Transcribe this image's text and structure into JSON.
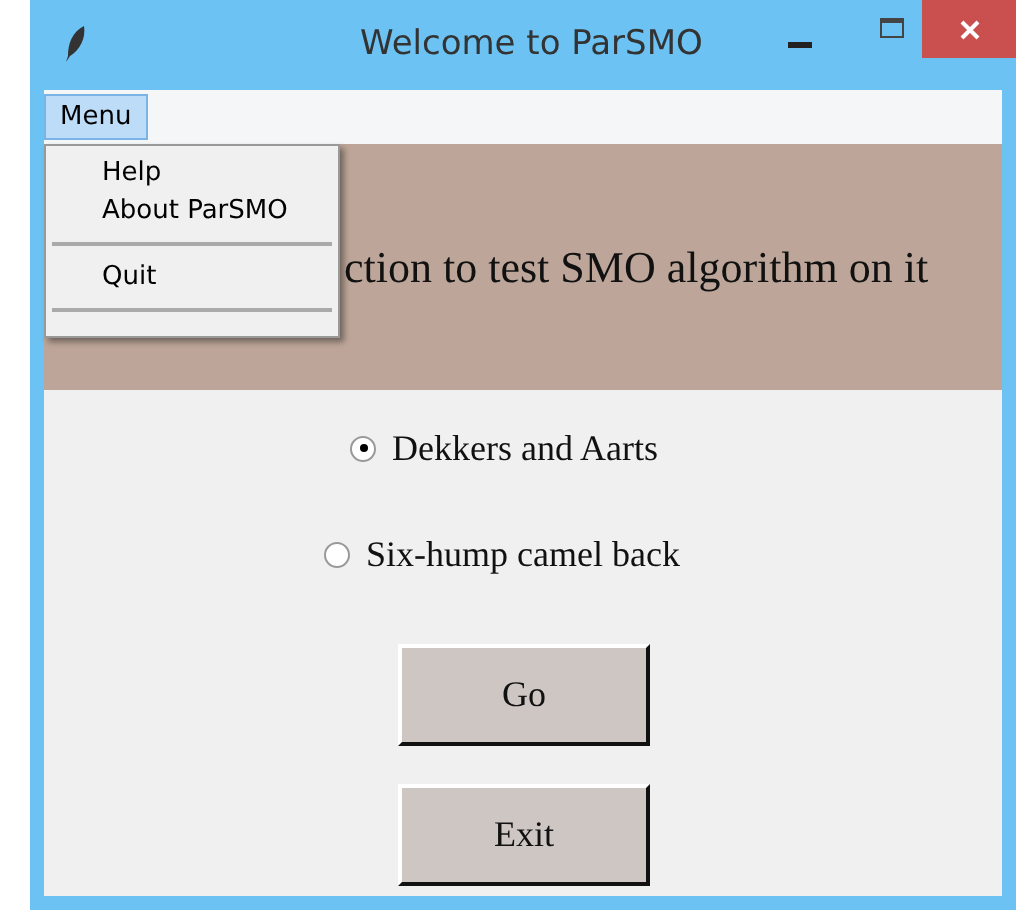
{
  "window": {
    "title": "Welcome to ParSMO"
  },
  "menu_bar": {
    "label": "Menu",
    "selected": true
  },
  "menu_dropdown": {
    "items": [
      {
        "kind": "item",
        "label": "Help"
      },
      {
        "kind": "item",
        "label": "About ParSMO"
      },
      {
        "kind": "separator"
      },
      {
        "kind": "item",
        "label": "Quit"
      },
      {
        "kind": "separator"
      }
    ]
  },
  "banner": {
    "text": "ction to test SMO algorithm on it"
  },
  "options": [
    {
      "label": "Dekkers and Aarts",
      "selected": true
    },
    {
      "label": "Six-hump camel back",
      "selected": false
    }
  ],
  "buttons": [
    "Go",
    "Exit"
  ]
}
